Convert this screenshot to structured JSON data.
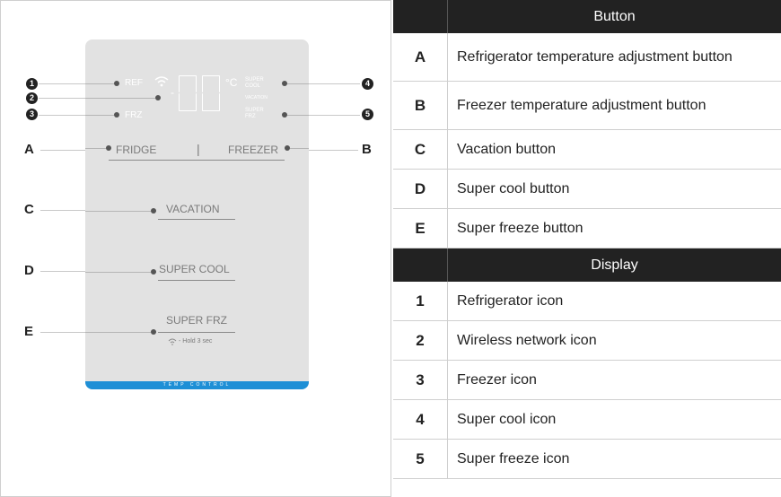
{
  "panel": {
    "ref_label": "REF",
    "frz_label": "FRZ",
    "temp_digits": "88",
    "minus": "-",
    "unit": "°C",
    "super_cool_icon": "SUPER COOL",
    "vacation_icon": "VACATION",
    "super_frz_icon": "SUPER FRZ",
    "fridge_button": "FRIDGE",
    "freezer_button": "FREEZER",
    "divider": "|",
    "vacation_button": "VACATION",
    "super_cool_button": "SUPER COOL",
    "super_frz_button": "SUPER FRZ",
    "hold_note": "- Hold 3 sec",
    "bottom_label": "TEMP CONTROL",
    "accent_color": "#1e8fd6",
    "wifi_icon": "wifi-icon"
  },
  "callouts": {
    "numbers": [
      "1",
      "2",
      "3",
      "4",
      "5"
    ],
    "letters": [
      "A",
      "B",
      "C",
      "D",
      "E"
    ]
  },
  "table": {
    "button_header": "Button",
    "display_header": "Display",
    "buttons": [
      {
        "key": "A",
        "desc": "Refrigerator temperature adjustment button"
      },
      {
        "key": "B",
        "desc": "Freezer temperature adjustment button"
      },
      {
        "key": "C",
        "desc": "Vacation button"
      },
      {
        "key": "D",
        "desc": "Super cool button"
      },
      {
        "key": "E",
        "desc": "Super freeze button"
      }
    ],
    "display": [
      {
        "key": "1",
        "desc": "Refrigerator icon"
      },
      {
        "key": "2",
        "desc": "Wireless network icon"
      },
      {
        "key": "3",
        "desc": "Freezer icon"
      },
      {
        "key": "4",
        "desc": "Super cool icon"
      },
      {
        "key": "5",
        "desc": "Super freeze icon"
      }
    ]
  }
}
